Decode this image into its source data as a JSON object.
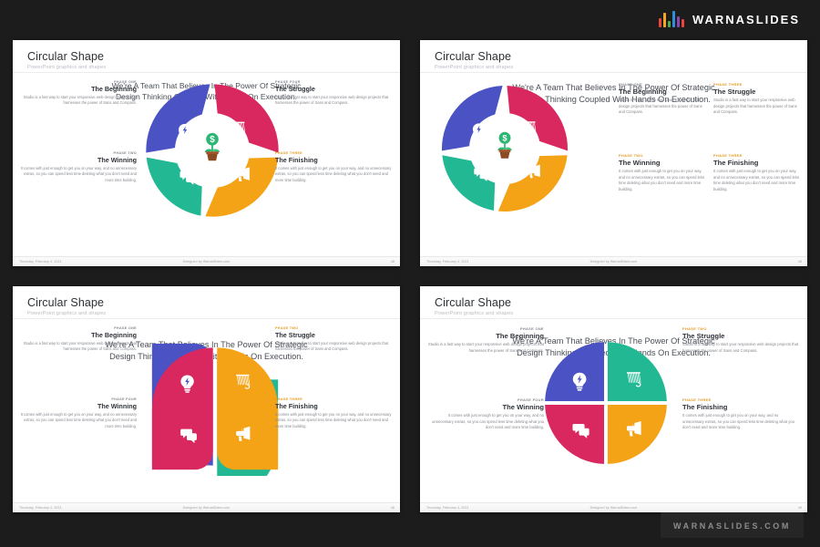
{
  "brand": {
    "name": "WARNASLIDES",
    "bar_colors": [
      "#e8453c",
      "#f5a623",
      "#4caf50",
      "#2f8fd8",
      "#8e44ad",
      "#e8453c"
    ]
  },
  "watermark": {
    "text": "WARNASLIDES.COM"
  },
  "colors": {
    "blue": "#4a52c4",
    "pink": "#d9275f",
    "orange": "#f5a316",
    "teal": "#23b894",
    "accent_orange_label": "#e39a1c",
    "title": "#2c2f34",
    "body": "#86898f",
    "heading": "#4a4f57"
  },
  "slide_common": {
    "title": "Circular Shape",
    "subtitle": "PowerPoint graphics and shapes",
    "heading_line1": "We're A Team That Believes In The Power Of Strategic",
    "heading_line2": "Design Thinking Coupled With Hands On Execution.",
    "footer_date": "Thursday, February 4, 2021",
    "footer_credit": "Designed by WarnaSlides.com",
    "body_text_a": "Studio is a fast way to start your responsive web design projects that harnesses the power of Sans and Compass.",
    "body_text_b": "It comes with just enough to get you on your way, and no unnecessary extras, so you can spend less time deleting what you don't need and more time building."
  },
  "slides": [
    {
      "id": "slide-1",
      "page_number": "48",
      "graphic": "pinwheel-ring",
      "blocks": [
        {
          "phase": "PHASE ONE",
          "phase_color": "#86898f",
          "title": "The Beginning",
          "body_key": "a",
          "align": "right",
          "pos": "left-top"
        },
        {
          "phase": "PHASE TWO",
          "phase_color": "#86898f",
          "title": "The Winning",
          "body_key": "b",
          "align": "right",
          "pos": "left-bottom"
        },
        {
          "phase": "PHASE FOUR",
          "phase_color": "#86898f",
          "title": "The Struggle",
          "body_key": "a",
          "align": "left",
          "pos": "right-top"
        },
        {
          "phase": "PHASE THREE",
          "phase_color": "#e39a1c",
          "title": "The Finishing",
          "body_key": "b",
          "align": "left",
          "pos": "right-bottom"
        }
      ]
    },
    {
      "id": "slide-2",
      "page_number": "48",
      "graphic": "pinwheel-ring",
      "blocks": [
        {
          "phase": "PHASE ONE",
          "phase_color": "#86898f",
          "title": "The Beginning",
          "body_key": "a",
          "align": "left",
          "pos": "mid-left-top"
        },
        {
          "phase": "PHASE TWO",
          "phase_color": "#e39a1c",
          "title": "The Winning",
          "body_key": "b",
          "align": "left",
          "pos": "mid-left-bottom"
        },
        {
          "phase": "PHASE THREE",
          "phase_color": "#e39a1c",
          "title": "The Struggle",
          "body_key": "a",
          "align": "left",
          "pos": "mid-right-top"
        },
        {
          "phase": "PHASE THREE",
          "phase_color": "#e39a1c",
          "title": "The Finishing",
          "body_key": "b",
          "align": "left",
          "pos": "mid-right-bottom"
        }
      ]
    },
    {
      "id": "slide-3",
      "page_number": "48",
      "graphic": "quad-petals",
      "blocks": [
        {
          "phase": "PHASE ONE",
          "phase_color": "#86898f",
          "title": "The Beginning",
          "body_key": "a",
          "align": "right",
          "pos": "left-top"
        },
        {
          "phase": "PHASE FOUR",
          "phase_color": "#86898f",
          "title": "The Winning",
          "body_key": "b",
          "align": "right",
          "pos": "left-bottom"
        },
        {
          "phase": "PHASE TWO",
          "phase_color": "#e39a1c",
          "title": "The Struggle",
          "body_key": "a",
          "align": "left",
          "pos": "right-top"
        },
        {
          "phase": "PHASE THREE",
          "phase_color": "#e39a1c",
          "title": "The Finishing",
          "body_key": "b",
          "align": "left",
          "pos": "right-bottom"
        }
      ]
    },
    {
      "id": "slide-4",
      "page_number": "48",
      "graphic": "quad-circle",
      "blocks": [
        {
          "phase": "PHASE ONE",
          "phase_color": "#86898f",
          "title": "The Beginning",
          "body_key": "a",
          "align": "right",
          "pos": "left-top"
        },
        {
          "phase": "PHASE FOUR",
          "phase_color": "#86898f",
          "title": "The Winning",
          "body_key": "b",
          "align": "right",
          "pos": "left-bottom"
        },
        {
          "phase": "PHASE TWO",
          "phase_color": "#e39a1c",
          "title": "The Struggle",
          "body_key": "a",
          "align": "left",
          "pos": "right-top"
        },
        {
          "phase": "PHASE THREE",
          "phase_color": "#e39a1c",
          "title": "The Finishing",
          "body_key": "b",
          "align": "left",
          "pos": "right-bottom"
        }
      ]
    }
  ],
  "icons": {
    "center": "money-plant-icon",
    "seg_blue": "lightbulb-icon",
    "seg_pink_or_teal": "hand-megaphone-icon",
    "seg_orange": "speaker-announcement-icon",
    "seg_teal_or_pink": "chat-bubbles-icon"
  }
}
